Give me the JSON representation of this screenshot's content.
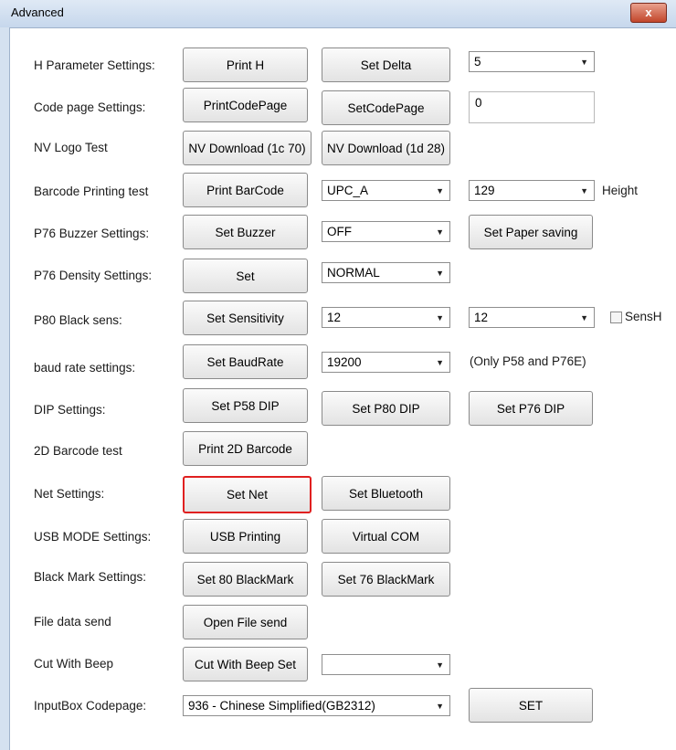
{
  "window": {
    "title": "Advanced",
    "close_glyph": "x"
  },
  "labels": {
    "h_param": "H Parameter Settings:",
    "code_page": "Code page Settings:",
    "nv_logo": "NV Logo Test",
    "barcode": "Barcode Printing test",
    "buzzer": "P76 Buzzer Settings:",
    "density": "P76 Density Settings:",
    "black_sens": "P80 Black sens:",
    "baud": "baud rate settings:",
    "dip": "DIP Settings:",
    "barcode2d": "2D Barcode test",
    "net": "Net Settings:",
    "usb": "USB MODE Settings:",
    "black_mark": "Black Mark Settings:",
    "file_send": "File data send",
    "cut_beep": "Cut With Beep",
    "input_codepage": "InputBox Codepage:",
    "height": "Height",
    "sensh": "SensH",
    "baud_note": "(Only P58 and P76E)"
  },
  "buttons": {
    "print_h": "Print H",
    "set_delta": "Set Delta",
    "print_codepage": "PrintCodePage",
    "set_codepage": "SetCodePage",
    "nv_dl_1c70": "NV Download (1c 70)",
    "nv_dl_1d28": "NV Download (1d 28)",
    "print_barcode": "Print BarCode",
    "set_buzzer": "Set Buzzer",
    "set_paper_saving": "Set Paper saving",
    "set_density": "Set",
    "set_sensitivity": "Set Sensitivity",
    "set_baudrate": "Set BaudRate",
    "set_p58_dip": "Set P58 DIP",
    "set_p80_dip": "Set P80 DIP",
    "set_p76_dip": "Set P76 DIP",
    "print_2d": "Print 2D Barcode",
    "set_net": "Set Net",
    "set_bluetooth": "Set Bluetooth",
    "usb_printing": "USB Printing",
    "virtual_com": "Virtual COM",
    "set80_blackmark": "Set 80 BlackMark",
    "set76_blackmark": "Set 76 BlackMark",
    "open_file_send": "Open File send",
    "cut_beep_set": "Cut With Beep Set",
    "set_codepage_final": "SET"
  },
  "combos": {
    "delta": "5",
    "barcode_type": "UPC_A",
    "barcode_height": "129",
    "buzzer": "OFF",
    "density": "NORMAL",
    "sens1": "12",
    "sens2": "12",
    "baud": "19200",
    "cut_beep": "",
    "input_codepage": "936 - Chinese Simplified(GB2312)"
  },
  "textboxes": {
    "codepage": "0"
  },
  "icons": {
    "dropdown": "▼"
  }
}
